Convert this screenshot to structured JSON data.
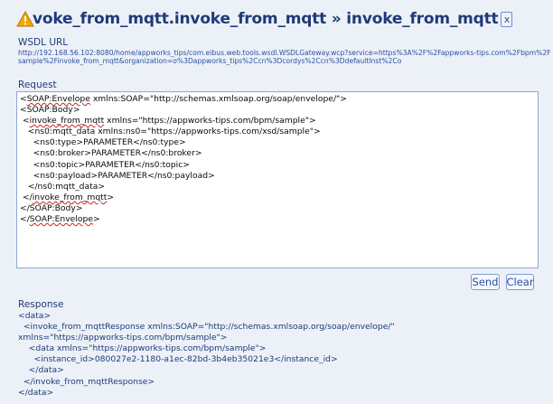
{
  "header": {
    "title": "voke_from_mqtt.invoke_from_mqtt » invoke_from_mqtt",
    "close_label": "x"
  },
  "wsdl": {
    "label": "WSDL URL",
    "url": "http://192.168.56.102:8080/home/appworks_tips/com.eibus.web.tools.wsdl.WSDLGateway.wcp?service=https%3A%2F%2Fappworks-tips.com%2Fbpm%2Fsample%2Finvoke_from_mqtt&organization=o%3Dappworks_tips%2Ccn%3Dcordys%2Ccn%3DdefaultInst%2Co"
  },
  "request": {
    "label": "Request",
    "lines": [
      {
        "pre": "<",
        "sq": "SOAP:Envelope",
        "post": " xmlns:SOAP=\"http://schemas.xmlsoap.org/soap/envelope/\">"
      },
      {
        "pre": "<SOAP:Body>",
        "sq": "",
        "post": ""
      },
      {
        "pre": " <",
        "sq": "invoke_from_mqtt",
        "post": " xmlns=\"https://appworks-tips.com/bpm/sample\">"
      },
      {
        "pre": "   <ns0:mqtt_data xmlns:ns0=\"https://appworks-tips.com/xsd/sample\">",
        "sq": "",
        "post": ""
      },
      {
        "pre": "     <ns0:type>PARAMETER</ns0:type>",
        "sq": "",
        "post": ""
      },
      {
        "pre": "     <ns0:broker>PARAMETER</ns0:broker>",
        "sq": "",
        "post": ""
      },
      {
        "pre": "     <ns0:topic>PARAMETER</ns0:topic>",
        "sq": "",
        "post": ""
      },
      {
        "pre": "     <ns0:payload>PARAMETER</ns0:payload>",
        "sq": "",
        "post": ""
      },
      {
        "pre": "   </ns0:mqtt_data>",
        "sq": "",
        "post": ""
      },
      {
        "pre": " </",
        "sq": "invoke_from_mqtt",
        "post": ">"
      },
      {
        "pre": "</SOAP:Body>",
        "sq": "",
        "post": ""
      },
      {
        "pre": "</",
        "sq": "SOAP:Envelope",
        "post": ">"
      }
    ]
  },
  "buttons": {
    "send_label": "Send",
    "clear_label": "Clear"
  },
  "response": {
    "label": "Response",
    "lines": [
      "<data>",
      "  <invoke_from_mqttResponse xmlns:SOAP=\"http://schemas.xmlsoap.org/soap/envelope/\"",
      "xmlns=\"https://appworks-tips.com/bpm/sample\">",
      "    <data xmlns=\"https://appworks-tips.com/bpm/sample\">",
      "      <instance_id>080027e2-1180-a1ec-82bd-3b4eb35021e3</instance_id>",
      "    </data>",
      "  </invoke_from_mqttResponse>",
      "</data>"
    ]
  },
  "colors": {
    "background": "#ecf1f8",
    "title": "#1f3a78",
    "warning": "#f4a800",
    "spellcheck": "#d32020"
  }
}
